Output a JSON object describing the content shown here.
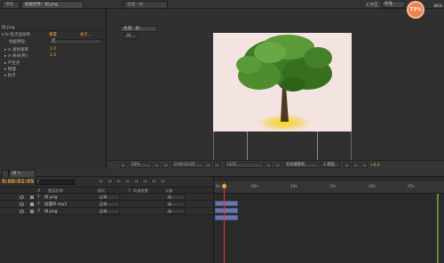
{
  "top": {
    "tabs": [
      {
        "label": "项目"
      },
      {
        "label": "效果控件：树.png"
      },
      {
        "label": "合成：树"
      }
    ],
    "workspace_label": "工作区:",
    "workspace_value": "标准",
    "cpu": "73%",
    "speed_up": "0K/S",
    "speed_down": "0K/S"
  },
  "left": {
    "title": "树.png",
    "effect_name": "粒子运动场",
    "effect_reset": "重置",
    "effect_about": "关于...",
    "anim_preset_label": "动画预设:",
    "anim_preset_value": "无",
    "rows": [
      {
        "label": "发射速率",
        "value": "1.0"
      },
      {
        "label": "寿命(秒)",
        "value": "1.0"
      },
      {
        "label": "产生点",
        "value": ""
      },
      {
        "label": "物理",
        "value": ""
      },
      {
        "label": "粒子",
        "value": ""
      }
    ]
  },
  "viewer": {
    "comp_tab": "合成：树",
    "sub_tab": "树",
    "zoom": "50%",
    "timecode": "0:00:01:05",
    "quality": "(1/2)",
    "view": "有效摄像机",
    "views": "1 视图",
    "offset": "+0.0"
  },
  "timeline": {
    "tab_label": "树",
    "timecode": "0:00:01:05",
    "columns": [
      "#",
      "图层名称",
      "模式",
      "T",
      "轨道遮罩",
      "父级"
    ],
    "layers": [
      {
        "num": "1",
        "name": "树.png",
        "mode": "正常",
        "parent": "无"
      },
      {
        "num": "2",
        "name": "动漫声.mp3",
        "mode": "正常",
        "parent": "无"
      },
      {
        "num": "3",
        "name": "树.png",
        "mode": "正常",
        "parent": "无"
      }
    ],
    "ruler": [
      "0s",
      "05s",
      "10s",
      "15s",
      "20s",
      "25s"
    ]
  },
  "colors": {
    "accent_orange": "#e8a73a",
    "layer_bar": "#6c75a8",
    "playhead": "#dd3333",
    "canvas_bg": "#f4e4e1"
  }
}
